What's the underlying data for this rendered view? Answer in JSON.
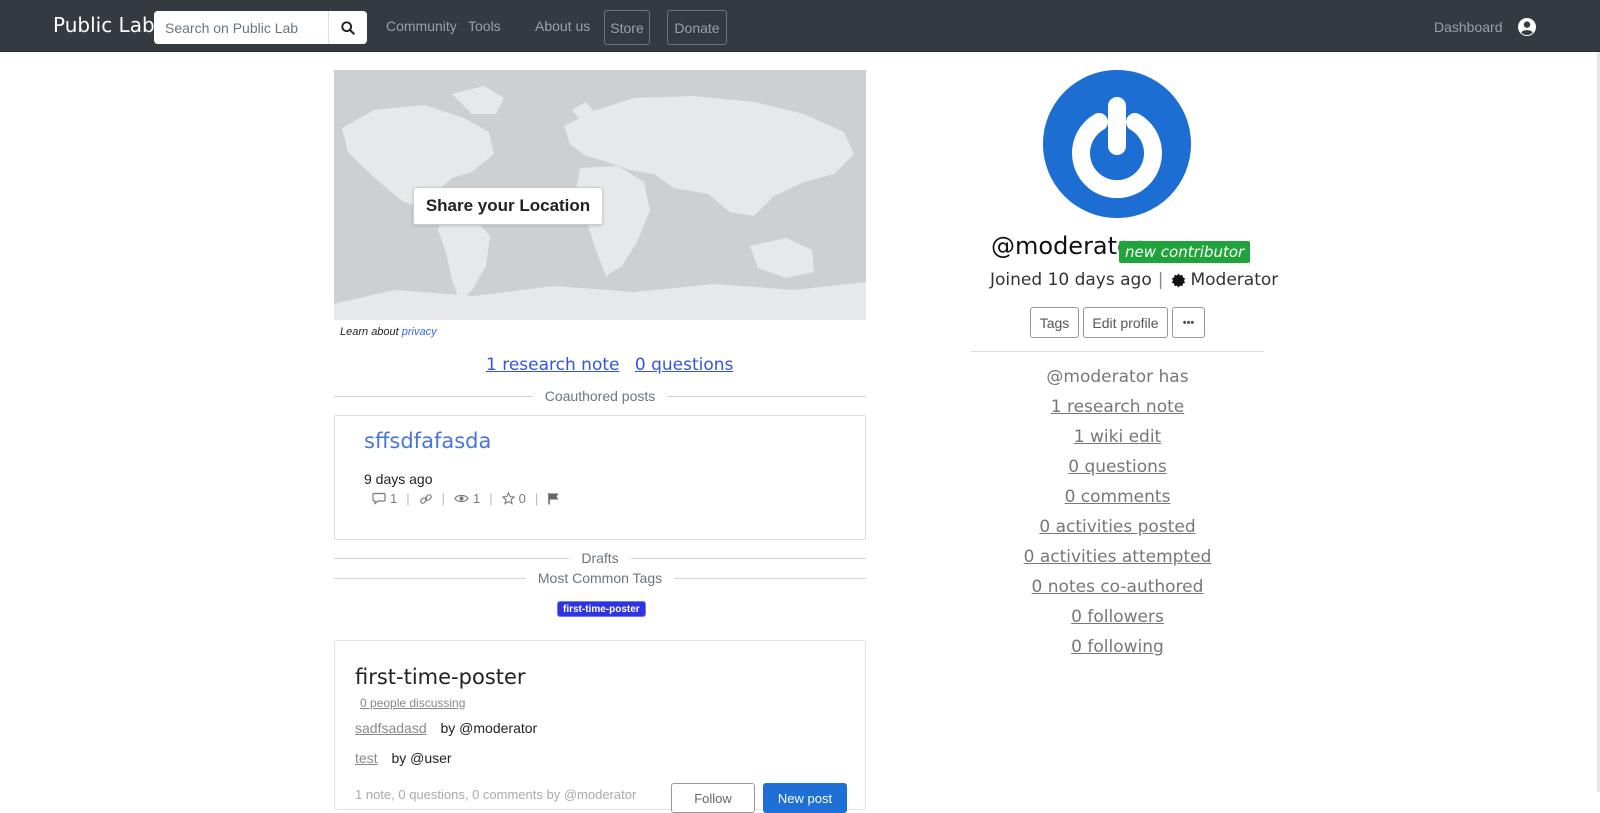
{
  "navbar": {
    "brand": "Public Lab",
    "search_placeholder": "Search on Public Lab",
    "links": [
      "Community",
      "Tools",
      "About us"
    ],
    "store_label": "Store",
    "donate_label": "Donate",
    "dashboard_label": "Dashboard"
  },
  "map": {
    "share_label": "Share your Location",
    "privacy_prefix": "Learn about",
    "privacy_link": "privacy"
  },
  "counts": {
    "research_notes": "1 research note",
    "questions": "0 questions"
  },
  "sections": {
    "coauthored": "Coauthored posts",
    "drafts": "Drafts",
    "common_tags": "Most Common Tags"
  },
  "post": {
    "title": "sffsdfafasda",
    "time": "9 days ago",
    "comments": "1",
    "views": "1",
    "likes": "0"
  },
  "common_tag": "first-time-poster",
  "tag_card": {
    "title": "first-time-poster",
    "people": "0 people discussing",
    "rows": [
      {
        "link": "sadfsadasd",
        "author": "by @moderator"
      },
      {
        "link": "test",
        "author": "by @user"
      }
    ],
    "footer_text": "1 note, 0 questions, 0 comments by @moderator",
    "follow_label": "Follow",
    "new_post_label": "New post"
  },
  "profile": {
    "username": "@moderator",
    "badge": "new contributor",
    "joined": "Joined 10 days ago",
    "role": "Moderator",
    "btn_tags": "Tags",
    "btn_edit": "Edit profile",
    "btn_more": "•••",
    "has_label": "@moderator has",
    "stats": [
      "1 research note",
      "1 wiki edit",
      "0 questions",
      "0 comments",
      "0 activities posted",
      "0 activities attempted",
      "0 notes co-authored",
      "0 followers",
      "0 following"
    ]
  },
  "colors": {
    "navbar_bg": "#343a40",
    "link_blue": "#3355dd",
    "badge_green": "#20a33a",
    "tag_blue": "#2f33e0",
    "avatar_blue": "#1c6ed2"
  }
}
